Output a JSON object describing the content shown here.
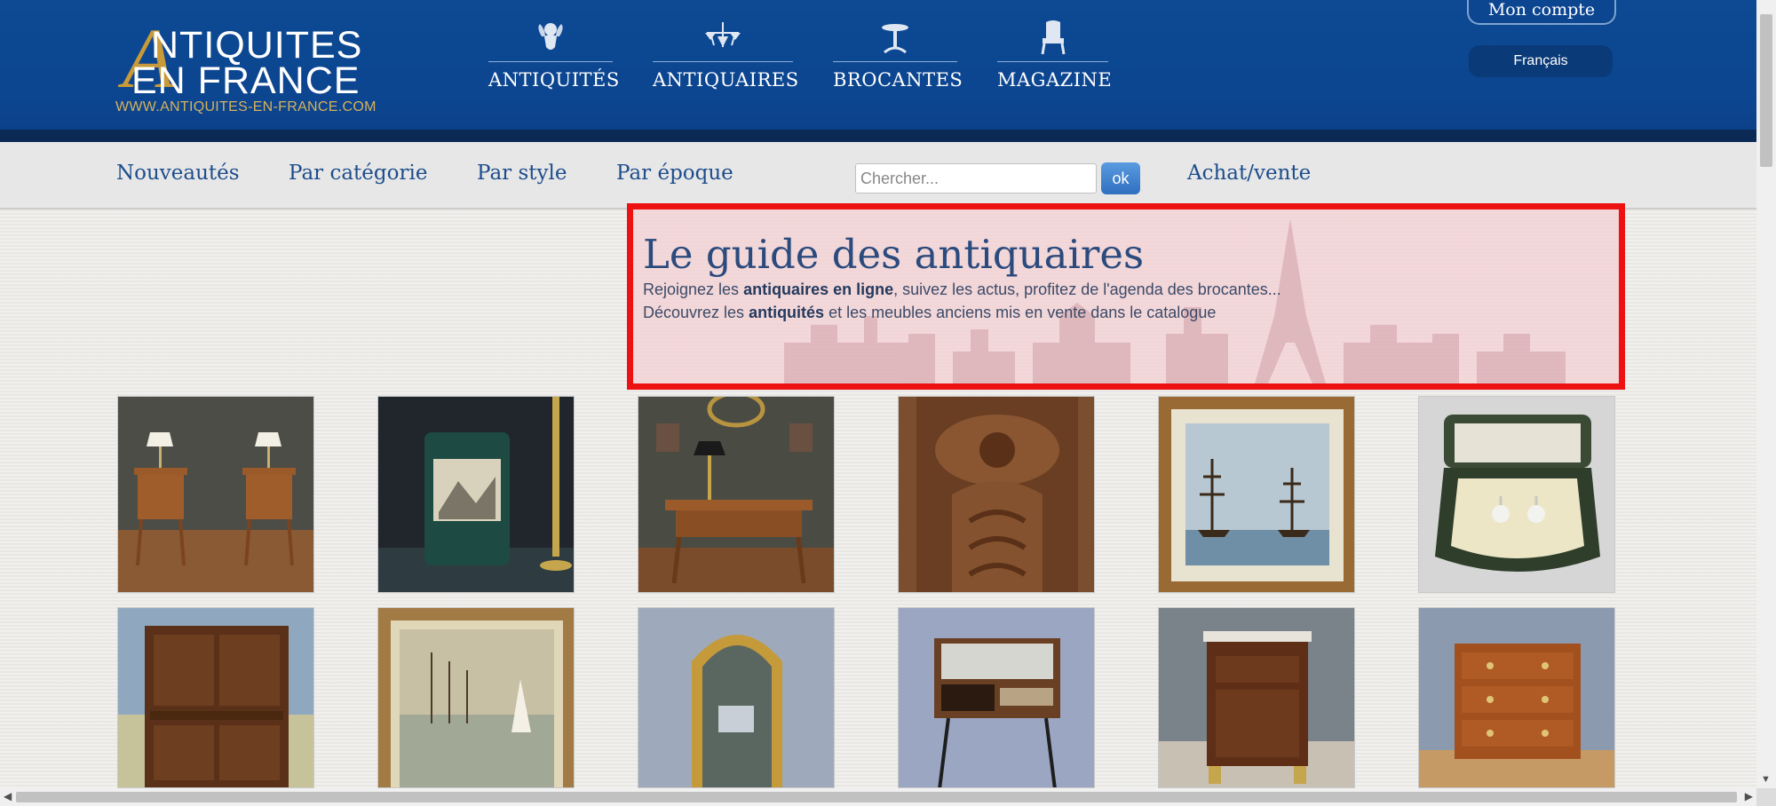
{
  "header": {
    "logo": {
      "line1": "NTIQUITES",
      "line2": "EN FRANCE",
      "letter_a": "A",
      "url": "WWW.ANTIQUITES-EN-FRANCE.COM"
    },
    "nav": [
      {
        "label": "ANTIQUITÉS",
        "icon": "cherub-icon"
      },
      {
        "label": "ANTIQUAIRES",
        "icon": "chandelier-icon"
      },
      {
        "label": "BROCANTES",
        "icon": "pedestal-table-icon"
      },
      {
        "label": "MAGAZINE",
        "icon": "armchair-icon"
      }
    ],
    "account_label": "Mon compte",
    "language_label": "Français"
  },
  "subnav": {
    "links": [
      "Nouveautés",
      "Par catégorie",
      "Par style",
      "Par époque"
    ],
    "search": {
      "placeholder": "Chercher...",
      "button_label": "ok"
    },
    "achat_vente": "Achat/vente"
  },
  "hero": {
    "title": "Le guide des antiquaires",
    "line1": {
      "before": "Rejoignez les ",
      "bold": "antiquaires en ligne",
      "after": ", suivez les actus, profitez de l'agenda des brocantes..."
    },
    "line2": {
      "before": "Découvrez les ",
      "bold": "antiquités",
      "after": " et les meubles anciens mis en vente dans le catalogue"
    }
  },
  "gallery": [
    {
      "subject": "pair of bedside tables with lamps"
    },
    {
      "subject": "painted tole waste basket"
    },
    {
      "subject": "writing desk with lamp"
    },
    {
      "subject": "carved wooden panel"
    },
    {
      "subject": "framed painting of sailing ships"
    },
    {
      "subject": "earrings in jewellery box"
    },
    {
      "subject": "walnut buffet cabinet"
    },
    {
      "subject": "framed harbour painting"
    },
    {
      "subject": "gilded mirror"
    },
    {
      "subject": "vintage radio cabinet"
    },
    {
      "subject": "mahogany nightstand"
    },
    {
      "subject": "chest of drawers"
    }
  ],
  "colors": {
    "header_blue": "#0c4590",
    "gold": "#c89a3a",
    "link_blue": "#1d4d8c",
    "hero_border": "#ee1111"
  }
}
